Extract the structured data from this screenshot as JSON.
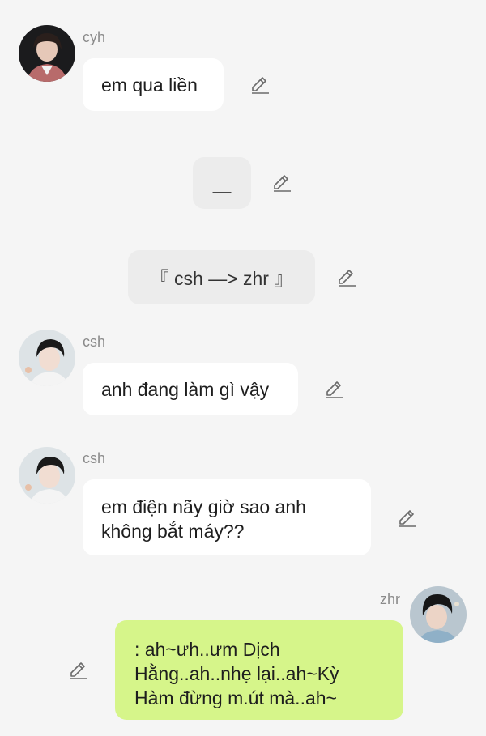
{
  "colors": {
    "background": "#f5f5f5",
    "bubble_white": "#ffffff",
    "bubble_gray": "#ececec",
    "bubble_green": "#d6f58a",
    "name_text": "#8a8a8a"
  },
  "messages": [
    {
      "sender": "cyh",
      "text": "em qua liền",
      "type": "incoming"
    },
    {
      "sender": "",
      "text": "＿",
      "type": "system"
    },
    {
      "sender": "",
      "text": "『 csh —> zhr 』",
      "type": "system"
    },
    {
      "sender": "csh",
      "text": "anh đang làm gì vậy",
      "type": "incoming"
    },
    {
      "sender": "csh",
      "text": "em điện nãy giờ sao anh\nkhông bắt máy??",
      "type": "incoming"
    },
    {
      "sender": "zhr",
      "text": ": ah~ưh..ưm Dịch\nHằng..ah..nhẹ lại..ah~Kỳ\nHàm đừng m.út mà..ah~",
      "type": "outgoing"
    }
  ],
  "icons": {
    "edit": "pencil-edit-icon",
    "avatar": "profile-avatar"
  }
}
